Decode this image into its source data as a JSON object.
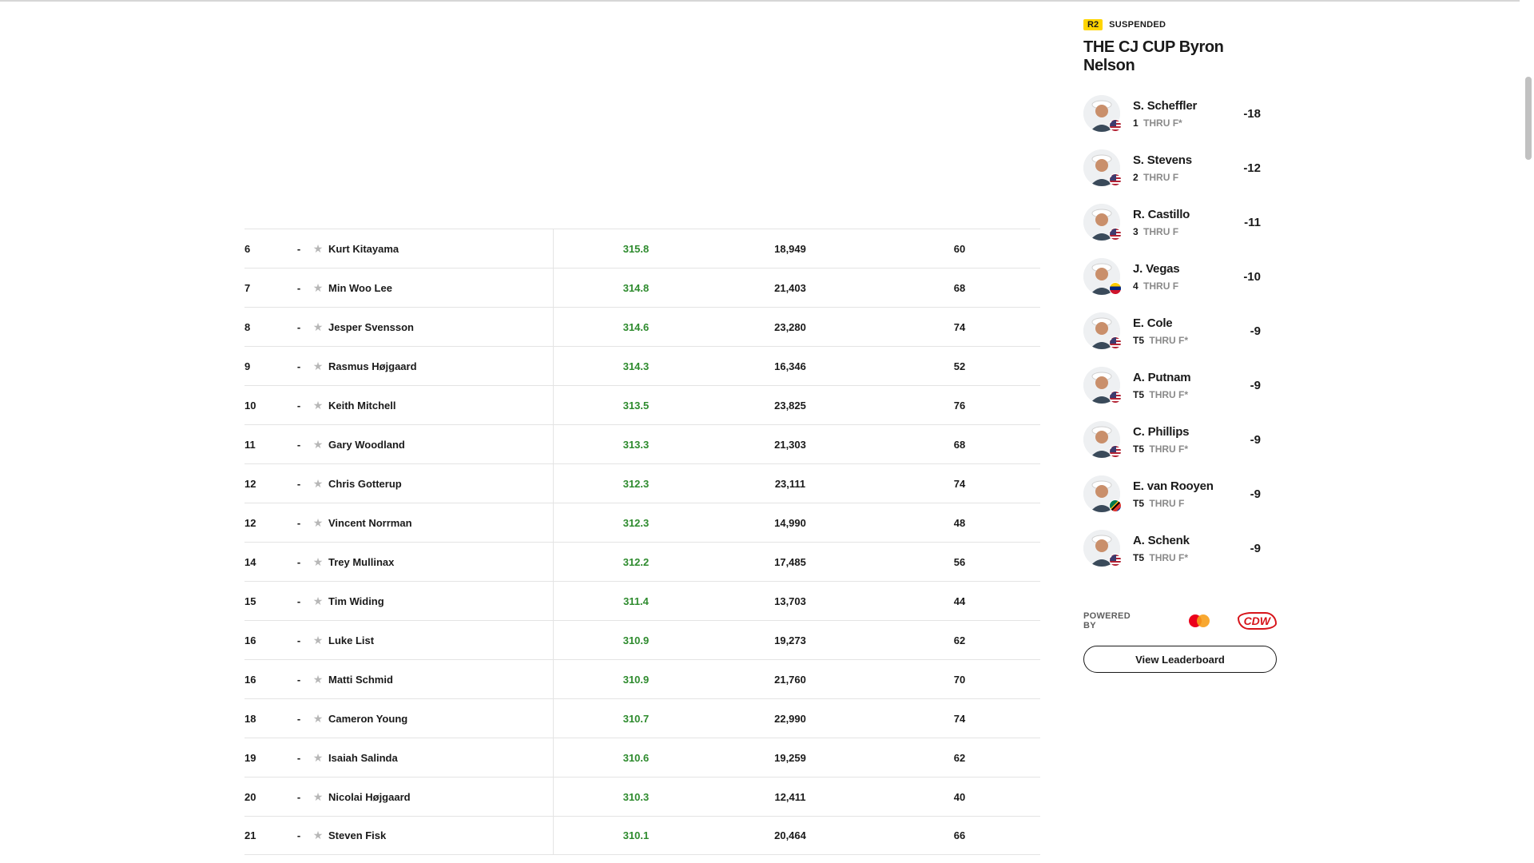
{
  "stats_table": {
    "rows": [
      {
        "pos": "6",
        "move": "-",
        "name": "Kurt Kitayama",
        "avg": "315.8",
        "total": "18,949",
        "attempts": "60"
      },
      {
        "pos": "7",
        "move": "-",
        "name": "Min Woo Lee",
        "avg": "314.8",
        "total": "21,403",
        "attempts": "68"
      },
      {
        "pos": "8",
        "move": "-",
        "name": "Jesper Svensson",
        "avg": "314.6",
        "total": "23,280",
        "attempts": "74"
      },
      {
        "pos": "9",
        "move": "-",
        "name": "Rasmus Højgaard",
        "avg": "314.3",
        "total": "16,346",
        "attempts": "52"
      },
      {
        "pos": "10",
        "move": "-",
        "name": "Keith Mitchell",
        "avg": "313.5",
        "total": "23,825",
        "attempts": "76"
      },
      {
        "pos": "11",
        "move": "-",
        "name": "Gary Woodland",
        "avg": "313.3",
        "total": "21,303",
        "attempts": "68"
      },
      {
        "pos": "12",
        "move": "-",
        "name": "Chris Gotterup",
        "avg": "312.3",
        "total": "23,111",
        "attempts": "74"
      },
      {
        "pos": "12",
        "move": "-",
        "name": "Vincent Norrman",
        "avg": "312.3",
        "total": "14,990",
        "attempts": "48"
      },
      {
        "pos": "14",
        "move": "-",
        "name": "Trey Mullinax",
        "avg": "312.2",
        "total": "17,485",
        "attempts": "56"
      },
      {
        "pos": "15",
        "move": "-",
        "name": "Tim Widing",
        "avg": "311.4",
        "total": "13,703",
        "attempts": "44"
      },
      {
        "pos": "16",
        "move": "-",
        "name": "Luke List",
        "avg": "310.9",
        "total": "19,273",
        "attempts": "62"
      },
      {
        "pos": "16",
        "move": "-",
        "name": "Matti Schmid",
        "avg": "310.9",
        "total": "21,760",
        "attempts": "70"
      },
      {
        "pos": "18",
        "move": "-",
        "name": "Cameron Young",
        "avg": "310.7",
        "total": "22,990",
        "attempts": "74"
      },
      {
        "pos": "19",
        "move": "-",
        "name": "Isaiah Salinda",
        "avg": "310.6",
        "total": "19,259",
        "attempts": "62"
      },
      {
        "pos": "20",
        "move": "-",
        "name": "Nicolai Højgaard",
        "avg": "310.3",
        "total": "12,411",
        "attempts": "40"
      },
      {
        "pos": "21",
        "move": "-",
        "name": "Steven Fisk",
        "avg": "310.1",
        "total": "20,464",
        "attempts": "66"
      }
    ],
    "star_icon": "star-icon",
    "colors": {
      "avg_value": "#2e8b2e",
      "star": "#b7b7b7",
      "row_border": "#e4e4e4"
    }
  },
  "leaderboard": {
    "round": "R2",
    "status": "SUSPENDED",
    "title": "THE CJ CUP Byron Nelson",
    "thru_label": "THRU",
    "players": [
      {
        "name": "S. Scheffler",
        "pos": "1",
        "thru": "F*",
        "score": "-18",
        "flag": "us"
      },
      {
        "name": "S. Stevens",
        "pos": "2",
        "thru": "F",
        "score": "-12",
        "flag": "us"
      },
      {
        "name": "R. Castillo",
        "pos": "3",
        "thru": "F",
        "score": "-11",
        "flag": "us"
      },
      {
        "name": "J. Vegas",
        "pos": "4",
        "thru": "F",
        "score": "-10",
        "flag": "ve"
      },
      {
        "name": "E. Cole",
        "pos": "T5",
        "thru": "F*",
        "score": "-9",
        "flag": "us"
      },
      {
        "name": "A. Putnam",
        "pos": "T5",
        "thru": "F*",
        "score": "-9",
        "flag": "us"
      },
      {
        "name": "C. Phillips",
        "pos": "T5",
        "thru": "F*",
        "score": "-9",
        "flag": "us"
      },
      {
        "name": "E. van Rooyen",
        "pos": "T5",
        "thru": "F",
        "score": "-9",
        "flag": "za"
      },
      {
        "name": "A. Schenk",
        "pos": "T5",
        "thru": "F*",
        "score": "-9",
        "flag": "us"
      }
    ],
    "powered_by": "POWERED BY",
    "sponsor_logos": [
      "mastercard-logo",
      "cdw-logo"
    ],
    "sponsor_text_cdw": "CDW",
    "button_label": "View Leaderboard",
    "colors": {
      "round_badge": "#ffd500",
      "cdw": "#d7141a"
    }
  }
}
